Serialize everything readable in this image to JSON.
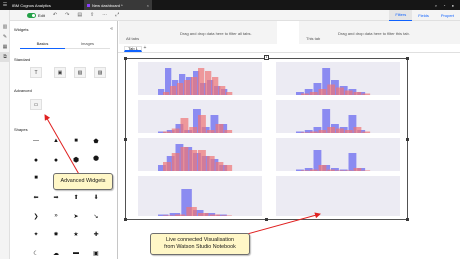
{
  "topbar": {
    "brand": "IBM Cognos Analytics",
    "tab_label": "New dashboard *"
  },
  "toolbar": {
    "edit_label": "Edit",
    "tabs": [
      "Filters",
      "Fields",
      "Propert"
    ]
  },
  "panel": {
    "title": "Widgets",
    "tabs": [
      "Basics",
      "Images"
    ],
    "sections": [
      "Standard",
      "Advanced",
      "Shapes"
    ]
  },
  "dropbar": {
    "all_tabs_label": "All tabs",
    "all_tabs_hint": "Drag and drop data here to filter all tabs.",
    "this_tab_label": "This tab",
    "this_tab_hint": "Drag and drop data here to filter this tab."
  },
  "canvas": {
    "tab_label": "Tab 1",
    "add_tab": "+"
  },
  "callouts": {
    "advanced": "Advanced Widgets",
    "live_line1": "Live connected Visualisation",
    "live_line2": "from Watson Studio Notebook"
  },
  "colors": {
    "series_blue": "#6b6bf0",
    "series_red": "#f07575",
    "series_purple": "#9a4fcf",
    "accent": "#0f62fe",
    "callout_bg": "#fff7c7",
    "arrow": "#e02020"
  }
}
